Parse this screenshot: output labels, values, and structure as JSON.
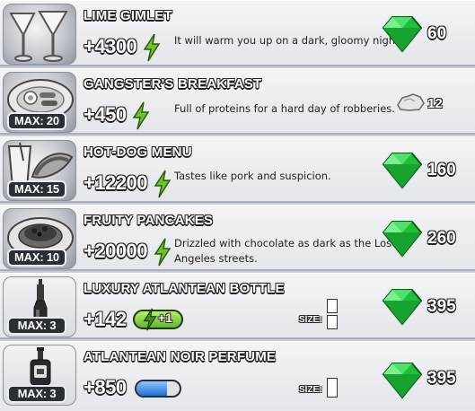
{
  "items": [
    {
      "name": "LIME GIMLET",
      "energy": "+4300",
      "description": "It will warm you up on a dark, gloomy night.",
      "price": "60",
      "currency": "gem",
      "max": ""
    },
    {
      "name": "GANGSTER'S BREAKFAST",
      "energy": "+450",
      "description": "Full of proteins for a hard day of robberies.",
      "price": "12",
      "currency": "silver-nugget",
      "max": "MAX: 20"
    },
    {
      "name": "HOT-DOG MENU",
      "energy": "+12200",
      "description": "Tastes like pork and suspicion.",
      "price": "160",
      "currency": "gem",
      "max": "MAX: 15"
    },
    {
      "name": "FRUITY PANCAKES",
      "energy": "+20000",
      "description_line1": "Drizzled with chocolate as dark as the Los",
      "description_line2": "Angeles streets.",
      "price": "260",
      "currency": "gem",
      "max": "MAX: 10"
    },
    {
      "name": "LUXURY ATLANTEAN BOTTLE",
      "energy": "+142",
      "bonus_badge": "+1",
      "size_label": "SIZE:",
      "price": "395",
      "currency": "gem",
      "max": "MAX: 3"
    },
    {
      "name": "ATLANTEAN NOIR PERFUME",
      "energy": "+850",
      "size_label": "SIZE:",
      "price": "395",
      "currency": "gem",
      "max": "MAX: 3",
      "bar_fill": 0.7
    }
  ],
  "colors": {
    "gem_green": "#1fbf3a",
    "energy_bolt": "#6cc62a",
    "bar_blue": "#1f6fd6"
  }
}
